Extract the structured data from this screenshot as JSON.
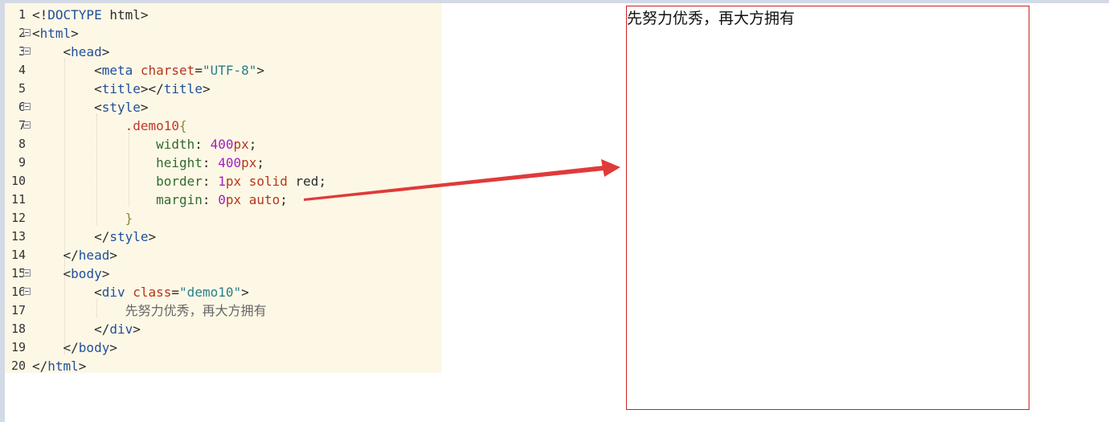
{
  "editor": {
    "lines": [
      {
        "n": "1",
        "fold": false,
        "parts": [
          [
            "t-punct",
            "<!"
          ],
          [
            "t-tag",
            "DOCTYPE"
          ],
          [
            "t-punct",
            " html>"
          ]
        ]
      },
      {
        "n": "2",
        "fold": true,
        "parts": [
          [
            "t-punct",
            "<"
          ],
          [
            "t-tag",
            "html"
          ],
          [
            "t-punct",
            ">"
          ]
        ]
      },
      {
        "n": "3",
        "fold": true,
        "parts": [
          [
            "t-plain",
            "    "
          ],
          [
            "t-punct",
            "<"
          ],
          [
            "t-tag",
            "head"
          ],
          [
            "t-punct",
            ">"
          ]
        ]
      },
      {
        "n": "4",
        "fold": false,
        "parts": [
          [
            "t-plain",
            "        "
          ],
          [
            "t-punct",
            "<"
          ],
          [
            "t-tag",
            "meta "
          ],
          [
            "t-attr",
            "charset"
          ],
          [
            "t-punct",
            "="
          ],
          [
            "t-str",
            "\"UTF-8\""
          ],
          [
            "t-punct",
            ">"
          ]
        ]
      },
      {
        "n": "5",
        "fold": false,
        "parts": [
          [
            "t-plain",
            "        "
          ],
          [
            "t-punct",
            "<"
          ],
          [
            "t-tag",
            "title"
          ],
          [
            "t-punct",
            "></"
          ],
          [
            "t-tag",
            "title"
          ],
          [
            "t-punct",
            ">"
          ]
        ]
      },
      {
        "n": "6",
        "fold": true,
        "parts": [
          [
            "t-plain",
            "        "
          ],
          [
            "t-punct",
            "<"
          ],
          [
            "t-tag",
            "style"
          ],
          [
            "t-punct",
            ">"
          ]
        ]
      },
      {
        "n": "7",
        "fold": true,
        "parts": [
          [
            "t-plain",
            "            "
          ],
          [
            "t-sel",
            ".demo10"
          ],
          [
            "t-brace",
            "{"
          ]
        ]
      },
      {
        "n": "8",
        "fold": false,
        "parts": [
          [
            "t-plain",
            "                "
          ],
          [
            "t-prop",
            "width"
          ],
          [
            "t-punct",
            ": "
          ],
          [
            "t-num",
            "400"
          ],
          [
            "t-kw",
            "px"
          ],
          [
            "t-punct",
            ";"
          ]
        ]
      },
      {
        "n": "9",
        "fold": false,
        "parts": [
          [
            "t-plain",
            "                "
          ],
          [
            "t-prop",
            "height"
          ],
          [
            "t-punct",
            ": "
          ],
          [
            "t-num",
            "400"
          ],
          [
            "t-kw",
            "px"
          ],
          [
            "t-punct",
            ";"
          ]
        ]
      },
      {
        "n": "10",
        "fold": false,
        "parts": [
          [
            "t-plain",
            "                "
          ],
          [
            "t-prop",
            "border"
          ],
          [
            "t-punct",
            ": "
          ],
          [
            "t-num",
            "1"
          ],
          [
            "t-kw",
            "px solid "
          ],
          [
            "t-plain",
            "red"
          ],
          [
            "t-punct",
            ";"
          ]
        ]
      },
      {
        "n": "11",
        "fold": false,
        "parts": [
          [
            "t-plain",
            "                "
          ],
          [
            "t-prop",
            "margin"
          ],
          [
            "t-punct",
            ": "
          ],
          [
            "t-num",
            "0"
          ],
          [
            "t-kw",
            "px auto"
          ],
          [
            "t-punct",
            ";"
          ]
        ]
      },
      {
        "n": "12",
        "fold": false,
        "parts": [
          [
            "t-plain",
            "            "
          ],
          [
            "t-brace",
            "}"
          ]
        ]
      },
      {
        "n": "13",
        "fold": false,
        "parts": [
          [
            "t-plain",
            "        "
          ],
          [
            "t-punct",
            "</"
          ],
          [
            "t-tag",
            "style"
          ],
          [
            "t-punct",
            ">"
          ]
        ]
      },
      {
        "n": "14",
        "fold": false,
        "parts": [
          [
            "t-plain",
            "    "
          ],
          [
            "t-punct",
            "</"
          ],
          [
            "t-tag",
            "head"
          ],
          [
            "t-punct",
            ">"
          ]
        ]
      },
      {
        "n": "15",
        "fold": true,
        "parts": [
          [
            "t-plain",
            "    "
          ],
          [
            "t-punct",
            "<"
          ],
          [
            "t-tag",
            "body"
          ],
          [
            "t-punct",
            ">"
          ]
        ]
      },
      {
        "n": "16",
        "fold": true,
        "parts": [
          [
            "t-plain",
            "        "
          ],
          [
            "t-punct",
            "<"
          ],
          [
            "t-tag",
            "div "
          ],
          [
            "t-attr",
            "class"
          ],
          [
            "t-punct",
            "="
          ],
          [
            "t-str",
            "\"demo10\""
          ],
          [
            "t-punct",
            ">"
          ]
        ]
      },
      {
        "n": "17",
        "fold": false,
        "parts": [
          [
            "t-plain",
            "            "
          ],
          [
            "t-text",
            "先努力优秀，再大方拥有"
          ]
        ]
      },
      {
        "n": "18",
        "fold": false,
        "parts": [
          [
            "t-plain",
            "        "
          ],
          [
            "t-punct",
            "</"
          ],
          [
            "t-tag",
            "div"
          ],
          [
            "t-punct",
            ">"
          ]
        ]
      },
      {
        "n": "19",
        "fold": false,
        "parts": [
          [
            "t-plain",
            "    "
          ],
          [
            "t-punct",
            "</"
          ],
          [
            "t-tag",
            "body"
          ],
          [
            "t-punct",
            ">"
          ]
        ]
      },
      {
        "n": "20",
        "fold": false,
        "parts": [
          [
            "t-punct",
            "</"
          ],
          [
            "t-tag",
            "html"
          ],
          [
            "t-punct",
            ">"
          ]
        ]
      }
    ]
  },
  "preview": {
    "text": "先努力优秀，再大方拥有",
    "border_color": "#cc2222"
  },
  "annotation": {
    "arrow_color": "#e03a3a"
  }
}
